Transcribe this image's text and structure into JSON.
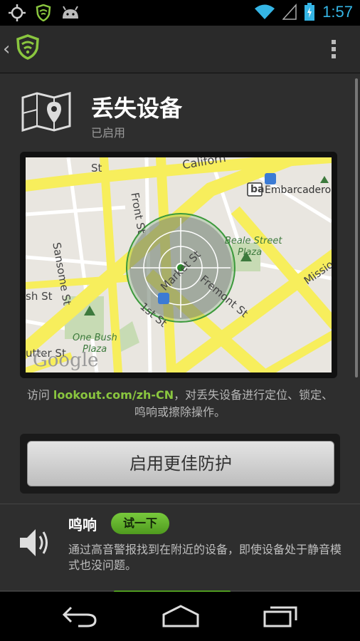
{
  "status_bar": {
    "time": "1:57",
    "icons": [
      "gps-icon",
      "lookout-shield-icon",
      "android-icon",
      "wifi-icon",
      "signal-icon",
      "battery-charging-icon"
    ]
  },
  "action_bar": {
    "icons": [
      "up-arrow-icon",
      "lookout-logo-icon",
      "overflow-menu-icon"
    ]
  },
  "feature": {
    "title": "丢失设备",
    "status": "已启用",
    "icon": "map-pin-icon"
  },
  "map": {
    "labels": {
      "california": "Californ",
      "st_top": "St",
      "front_st": "Front St",
      "embarcadero": "Embarcadero",
      "sansome_st": "Sansome St",
      "market_st": "Market St",
      "beale_plaza": "Beale Street",
      "plaza": "Plaza",
      "fremont_st": "Fremont St",
      "mission": "Mission",
      "bush_st": "sh St",
      "first_st": "1st St",
      "one_bush": "One Bush",
      "one_bush_plaza": "Plaza",
      "sutter_st": "utter St",
      "google": "Google",
      "ba_badge": "ba"
    }
  },
  "description": {
    "prefix": "访问 ",
    "link": "lookout.com/zh-CN",
    "suffix": "，对丢失设备进行定位、锁定、鸣响或擦除操作。"
  },
  "enable_button": {
    "label": "启用更佳防护"
  },
  "sound": {
    "title": "鸣响",
    "try_label": "试一下",
    "description": "通过高音警报找到在附近的设备，即使设备处于静音模式也没问题。",
    "icon": "speaker-icon"
  },
  "nav_bar": {
    "icons": [
      "back-icon",
      "home-icon",
      "recents-icon"
    ]
  },
  "colors": {
    "accent_green": "#8ac63f",
    "time_blue": "#35b5e5",
    "map_road": "#f7ee5c"
  }
}
